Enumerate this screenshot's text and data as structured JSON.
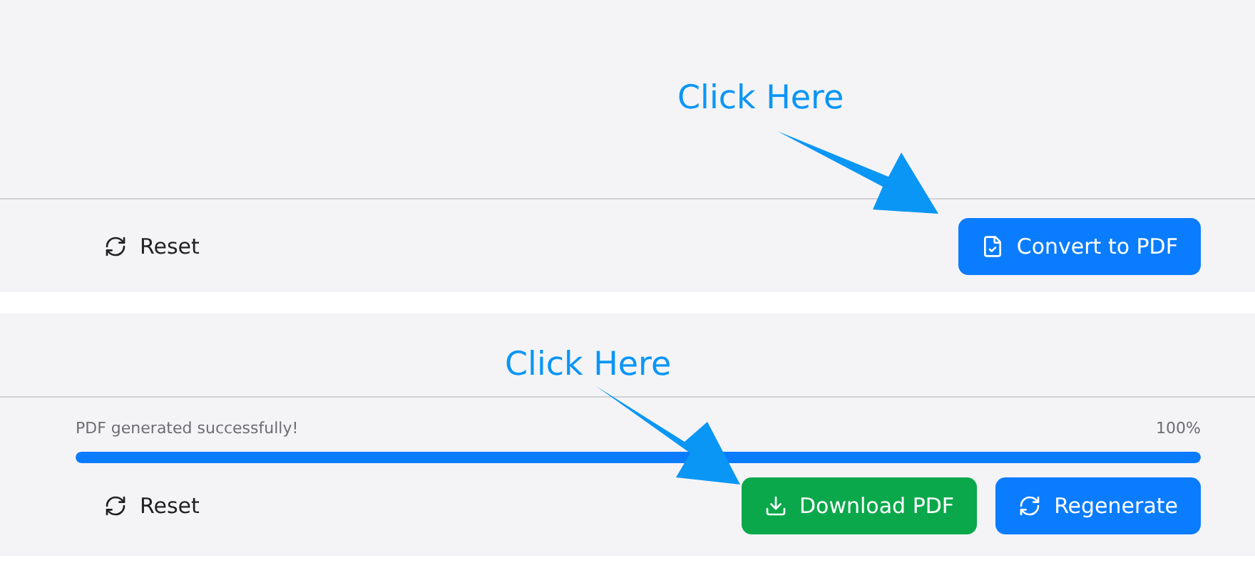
{
  "panels": [
    {
      "annotation": "Click Here",
      "buttons": [
        {
          "label": "Reset",
          "kind": "reset"
        },
        {
          "label": "Convert to PDF",
          "kind": "convert"
        }
      ]
    },
    {
      "annotation": "Click Here",
      "progress": {
        "status": "PDF generated successfully!",
        "percent": "100%",
        "level": 1
      },
      "buttons": [
        {
          "label": "Reset",
          "kind": "reset"
        },
        {
          "label": "Download PDF",
          "kind": "download"
        },
        {
          "label": "Regenerate",
          "kind": "regenerate"
        }
      ]
    }
  ]
}
